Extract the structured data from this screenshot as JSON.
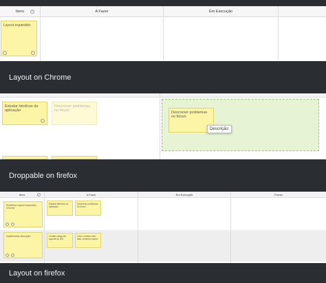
{
  "captions": {
    "chrome": "Layout on Chrome",
    "droppable": "Droppable on firefox",
    "firefox": "Layout on firefox"
  },
  "board_headers": {
    "itens": "Itens",
    "a_fazer": "A Fazer",
    "em_execucao": "Em Execução",
    "pronto": "Pronto"
  },
  "panel_chrome": {
    "item_note": "Layout expandido",
    "icon_plus": "+",
    "icon_add": "⊕"
  },
  "panel_droppable": {
    "card_study": "Estudar html/css da aplicação",
    "card_ghost": "Descrever problemas no fórum",
    "card_dragged": "Descrever problemas no fórum",
    "tooltip": "Descrição:"
  },
  "panel_firefox": {
    "item1": "Problema Layout expandido Chrome",
    "item2": "Implementar descrição",
    "task1": "Estudar html/css da aplicação",
    "task2": "Descrever problemas no fórum",
    "task3": "Ocultar código de suporte ao IE6",
    "task4": "Criar o mesmo site, tabs, columns, layout"
  },
  "colors": {
    "dark": "#2a2d32",
    "note_yellow": "#fdf5a6",
    "drop_green": "#e6f4d4"
  }
}
